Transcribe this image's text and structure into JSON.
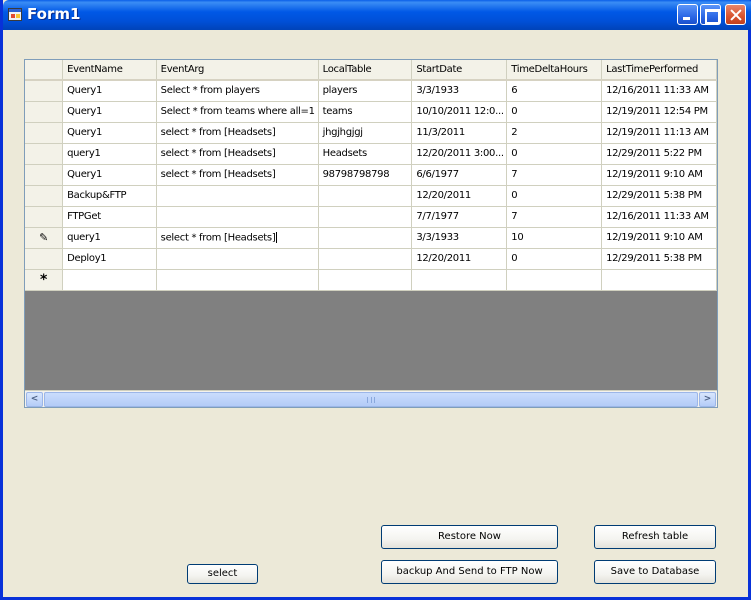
{
  "window": {
    "title": "Form1"
  },
  "grid": {
    "columns": [
      "EventName",
      "EventArg",
      "LocalTable",
      "StartDate",
      "TimeDeltaHours",
      "LastTimePerformed"
    ],
    "rows": [
      {
        "marker": "",
        "cells": [
          "Query1",
          "Select * from players",
          "players",
          "3/3/1933",
          "6",
          "12/16/2011 11:33 AM"
        ]
      },
      {
        "marker": "",
        "cells": [
          "Query1",
          "Select * from teams where all=1",
          "teams",
          "10/10/2011 12:0...",
          "0",
          "12/19/2011 12:54 PM"
        ]
      },
      {
        "marker": "",
        "cells": [
          "Query1",
          "select * from [Headsets]",
          "jhgjhgjgj",
          "11/3/2011",
          "2",
          "12/19/2011 11:13 AM"
        ]
      },
      {
        "marker": "",
        "cells": [
          "query1",
          "select * from [Headsets]",
          "Headsets",
          "12/20/2011 3:00...",
          "0",
          "12/29/2011 5:22 PM"
        ]
      },
      {
        "marker": "",
        "cells": [
          "Query1",
          "select * from [Headsets]",
          "98798798798",
          "6/6/1977",
          "7",
          "12/19/2011 9:10 AM"
        ]
      },
      {
        "marker": "",
        "cells": [
          "Backup&FTP",
          "",
          "",
          "12/20/2011",
          "0",
          "12/29/2011 5:38 PM"
        ]
      },
      {
        "marker": "",
        "cells": [
          "FTPGet",
          "",
          "",
          "7/7/1977",
          "7",
          "12/16/2011 11:33 AM"
        ]
      },
      {
        "marker": "edit",
        "cells": [
          "query1",
          "select * from [Headsets]",
          "",
          "3/3/1933",
          "10",
          "12/19/2011 9:10 AM"
        ]
      },
      {
        "marker": "",
        "cells": [
          "Deploy1",
          "",
          "",
          "12/20/2011",
          "0",
          "12/29/2011 5:38 PM"
        ]
      },
      {
        "marker": "new",
        "cells": [
          "",
          "",
          "",
          "",
          "",
          ""
        ]
      }
    ],
    "edit_marker_glyph": "✎",
    "new_row_glyph": "*",
    "scroll_left_glyph": "<",
    "scroll_right_glyph": ">"
  },
  "buttons": {
    "restore_now": "Restore Now",
    "refresh_table": "Refresh table",
    "backup_and_send": "backup And Send to FTP Now",
    "save_to_database": "Save to Database",
    "select": "select"
  }
}
